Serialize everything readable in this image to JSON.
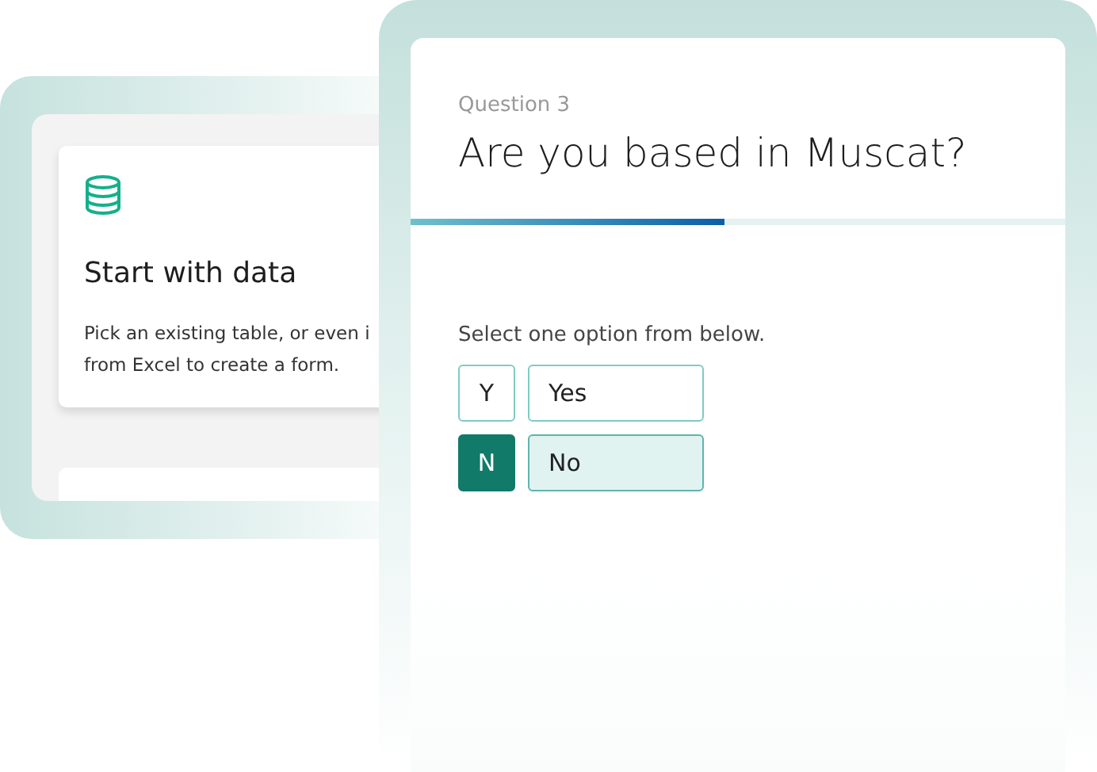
{
  "source_card": {
    "title": "Start with data",
    "description_lines": [
      "Pick an existing table, or even i",
      "from Excel to create a form."
    ]
  },
  "question": {
    "number": "Question 3",
    "title": "Are you based in Muscat?",
    "progress": {
      "level": 0.48
    },
    "instruction": "Select one option from below.",
    "options": [
      {
        "key": "Y",
        "label": "Yes",
        "selected": false
      },
      {
        "key": "N",
        "label": "No",
        "selected": true
      }
    ]
  }
}
